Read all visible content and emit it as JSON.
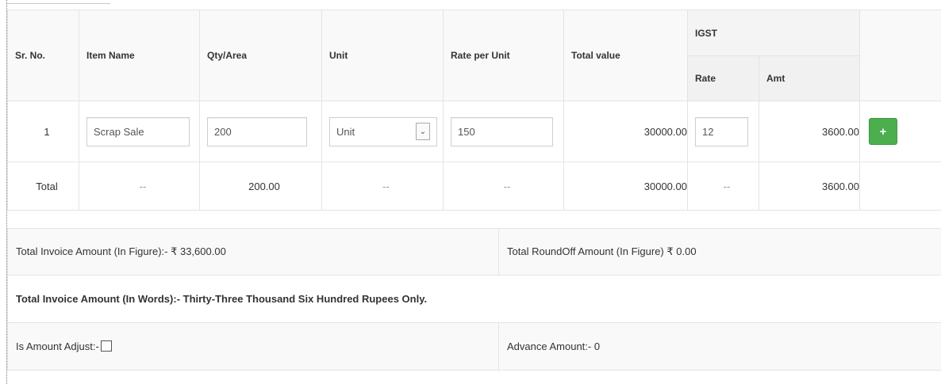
{
  "table": {
    "headers": {
      "sr_no": "Sr. No.",
      "item_name": "Item Name",
      "qty_area": "Qty/Area",
      "unit": "Unit",
      "rate_per_unit": "Rate per Unit",
      "total_value": "Total value",
      "igst": "IGST",
      "igst_rate": "Rate",
      "igst_amt": "Amt"
    },
    "row": {
      "sr_no": "1",
      "item_name": "Scrap Sale",
      "qty_area": "200",
      "unit": "Unit",
      "rate_per_unit": "150",
      "total_value": "30000.00",
      "igst_rate": "12",
      "igst_amt": "3600.00",
      "add_label": "+"
    },
    "total": {
      "label": "Total",
      "item_name": "--",
      "qty_area": "200.00",
      "unit": "--",
      "rate_per_unit": "--",
      "total_value": "30000.00",
      "igst_rate": "--",
      "igst_amt": "3600.00"
    }
  },
  "summary": {
    "invoice_amount_figure": "Total Invoice Amount (In Figure):- ₹ 33,600.00",
    "roundoff_amount_figure": "Total RoundOff Amount (In Figure) ₹ 0.00",
    "invoice_amount_words": "Total Invoice Amount (In Words):- Thirty-Three Thousand Six Hundred Rupees Only.",
    "is_amount_adjust": "Is Amount Adjust:-",
    "advance_amount": "Advance Amount:- 0"
  },
  "colors": {
    "add_button": "#4cae4c",
    "header_bg": "#f9f9f9",
    "border": "#e4e4e4"
  },
  "icons": {
    "add": "plus-icon",
    "select": "chevron-down-icon",
    "checkbox": "checkbox-icon"
  }
}
